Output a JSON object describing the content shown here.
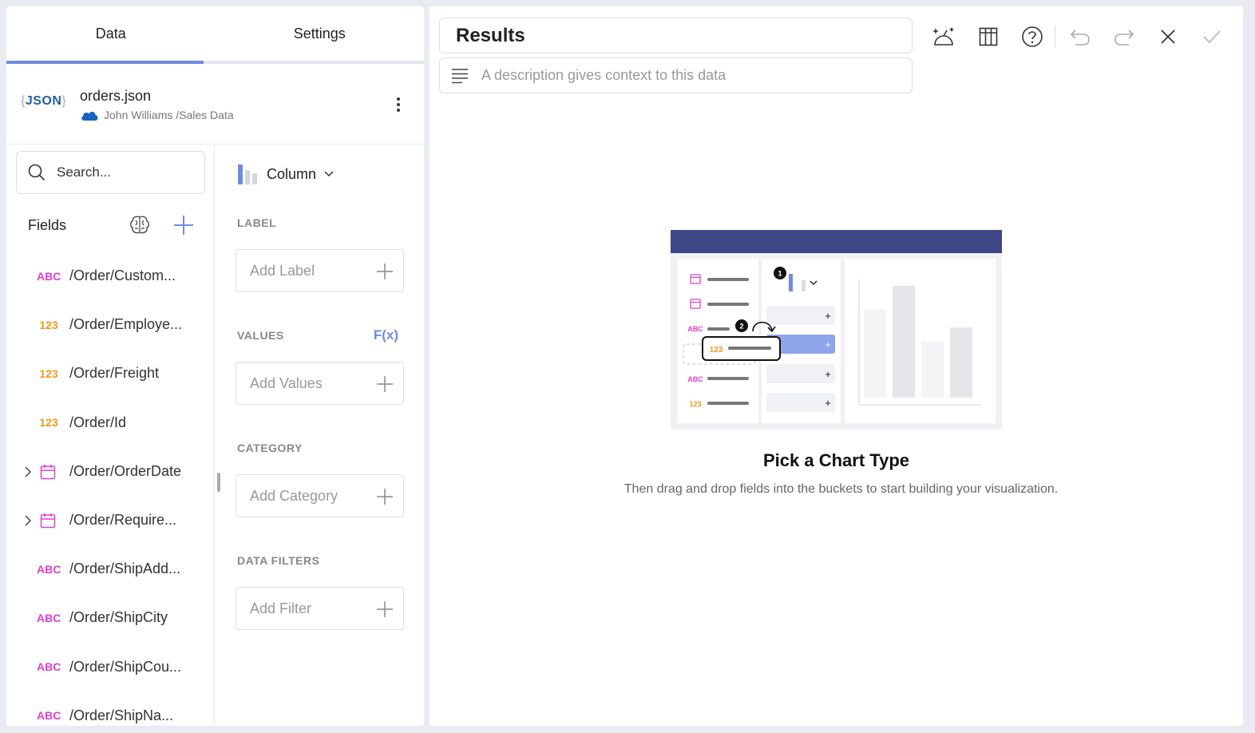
{
  "tabs": {
    "data_label": "Data",
    "settings_label": "Settings"
  },
  "source": {
    "logo_text": "JSON",
    "name": "orders.json",
    "path": "John Williams /Sales Data"
  },
  "search": {
    "placeholder": "Search..."
  },
  "fields": {
    "heading": "Fields",
    "items": [
      {
        "type": "ABC",
        "name": "/Order/Custom..."
      },
      {
        "type": "123",
        "name": "/Order/Employe..."
      },
      {
        "type": "123",
        "name": "/Order/Freight"
      },
      {
        "type": "123",
        "name": "/Order/Id"
      },
      {
        "type": "date",
        "name": "/Order/OrderDate"
      },
      {
        "type": "date",
        "name": "/Order/Require..."
      },
      {
        "type": "ABC",
        "name": "/Order/ShipAdd..."
      },
      {
        "type": "ABC",
        "name": "/Order/ShipCity"
      },
      {
        "type": "ABC",
        "name": "/Order/ShipCou..."
      },
      {
        "type": "ABC",
        "name": "/Order/ShipNa..."
      }
    ]
  },
  "chart_type": {
    "label": "Column"
  },
  "buckets": {
    "label": {
      "title": "LABEL",
      "placeholder": "Add Label"
    },
    "values": {
      "title": "VALUES",
      "fx": "F(x)",
      "placeholder": "Add Values"
    },
    "category": {
      "title": "CATEGORY",
      "placeholder": "Add Category"
    },
    "filters": {
      "title": "DATA FILTERS",
      "placeholder": "Add Filter"
    }
  },
  "editor": {
    "title": "Results",
    "description_placeholder": "A description gives context to this data"
  },
  "illustration": {
    "step1": "1",
    "step2": "2",
    "abc": "ABC",
    "num": "123",
    "plus": "+"
  },
  "empty_state": {
    "title": "Pick a Chart Type",
    "subtitle": "Then drag and drop fields into the buckets to start building your visualization."
  },
  "colors": {
    "accent": "#6f8ce0",
    "text_type": "#e040d0",
    "number_type": "#f29a17",
    "illustration_header": "#3d4785"
  }
}
